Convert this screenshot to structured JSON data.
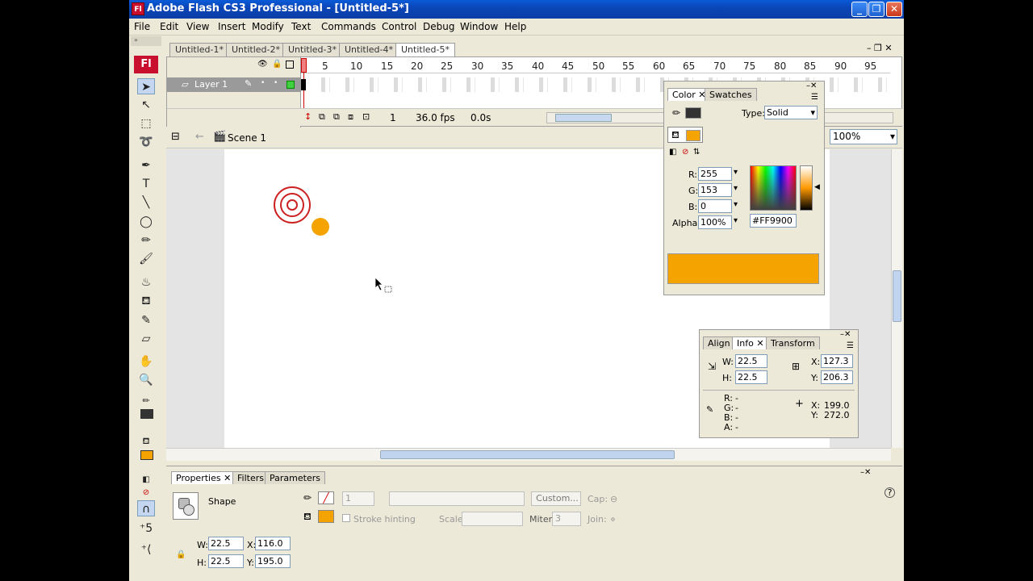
{
  "window": {
    "icon_text": "Fl",
    "title": "Adobe Flash CS3 Professional - [Untitled-5*]",
    "minimize": "_",
    "maximize": "❐",
    "close": "✕"
  },
  "menu": [
    "File",
    "Edit",
    "View",
    "Insert",
    "Modify",
    "Text",
    "Commands",
    "Control",
    "Debug",
    "Window",
    "Help"
  ],
  "tools": {
    "logo": "Fl",
    "stroke_color": "#333333",
    "fill_color": "#f5a300"
  },
  "documents": {
    "tabs": [
      "Untitled-1*",
      "Untitled-2*",
      "Untitled-3*",
      "Untitled-4*",
      "Untitled-5*"
    ],
    "active_index": 4
  },
  "timeline": {
    "layer_name": "Layer 1",
    "frame_numbers": [
      "1",
      "5",
      "10",
      "15",
      "20",
      "25",
      "30",
      "35",
      "40",
      "45",
      "50",
      "55",
      "60",
      "65",
      "70",
      "75",
      "80",
      "85",
      "90",
      "95"
    ],
    "current_frame": "1",
    "fps": "36.0 fps",
    "time": "0.0s"
  },
  "editbar": {
    "scene": "Scene 1",
    "zoom": "100%"
  },
  "color_panel": {
    "tabs": [
      "Color",
      "Swatches"
    ],
    "type_label": "Type:",
    "type_value": "Solid",
    "r_label": "R:",
    "r": "255",
    "g_label": "G:",
    "g": "153",
    "b_label": "B:",
    "b": "0",
    "alpha_label": "Alpha:",
    "alpha": "100%",
    "hex": "#FF9900",
    "fill_color": "#f5a300"
  },
  "info_panel": {
    "tabs": [
      "Align",
      "Info",
      "Transform"
    ],
    "w_label": "W:",
    "w": "22.5",
    "h_label": "H:",
    "h": "22.5",
    "x_label": "X:",
    "x": "127.3",
    "y_label": "Y:",
    "y": "206.3",
    "r_label": "R:",
    "r": "-",
    "g_label": "G:",
    "g": "-",
    "b_label": "B:",
    "b": "-",
    "a_label": "A:",
    "a": "-",
    "cursor_x_label": "X:",
    "cursor_x": "199.0",
    "cursor_y_label": "Y:",
    "cursor_y": "272.0"
  },
  "properties": {
    "tabs": [
      "Properties",
      "Filters",
      "Parameters"
    ],
    "object_type": "Shape",
    "stroke_height": "1",
    "custom_button": "Custom...",
    "cap_label": "Cap:",
    "stroke_hinting": "Stroke hinting",
    "scale_label": "Scale:",
    "miter_label": "Miter:",
    "miter": "3",
    "join_label": "Join:",
    "w_label": "W:",
    "w": "22.5",
    "h_label": "H:",
    "h": "22.5",
    "x_label": "X:",
    "x": "116.0",
    "y_label": "Y:",
    "y": "195.0",
    "fill_color": "#f5a300",
    "help": "?"
  }
}
